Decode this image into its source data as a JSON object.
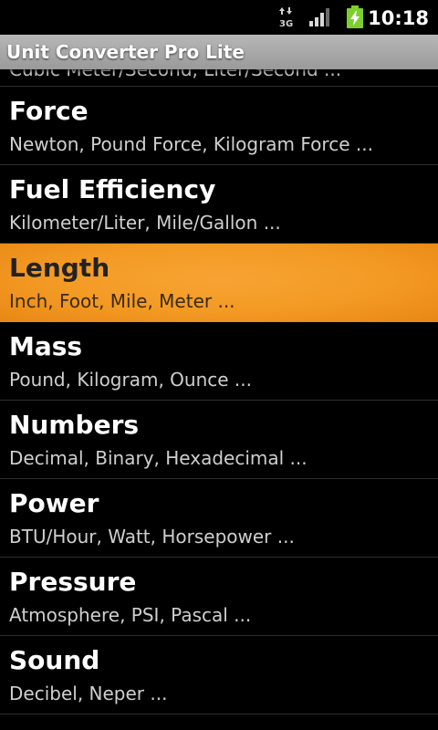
{
  "status_bar": {
    "network_type": "3G",
    "time": "10:18"
  },
  "app": {
    "title": "Unit Converter Pro Lite"
  },
  "list": {
    "partial_top_item_subtitle": "Cubic Meter/Second, Liter/Second ...",
    "items": [
      {
        "name": "Force",
        "units": "Newton, Pound Force, Kilogram Force ...",
        "selected": false
      },
      {
        "name": "Fuel Efficiency",
        "units": "Kilometer/Liter, Mile/Gallon ...",
        "selected": false
      },
      {
        "name": "Length",
        "units": "Inch, Foot, Mile, Meter ...",
        "selected": true
      },
      {
        "name": "Mass",
        "units": "Pound, Kilogram, Ounce ...",
        "selected": false
      },
      {
        "name": "Numbers",
        "units": "Decimal, Binary, Hexadecimal ...",
        "selected": false
      },
      {
        "name": "Power",
        "units": "BTU/Hour, Watt, Horsepower ...",
        "selected": false
      },
      {
        "name": "Pressure",
        "units": "Atmosphere, PSI, Pascal ...",
        "selected": false
      },
      {
        "name": "Sound",
        "units": "Decibel, Neper ...",
        "selected": false
      }
    ]
  },
  "colors": {
    "selection": "#f39a24",
    "background": "#000000",
    "title_bar": "#a8a8a8",
    "battery": "#7ccf2c"
  },
  "icons": [
    "data-arrows-icon",
    "signal-strength-icon",
    "battery-charging-icon"
  ]
}
